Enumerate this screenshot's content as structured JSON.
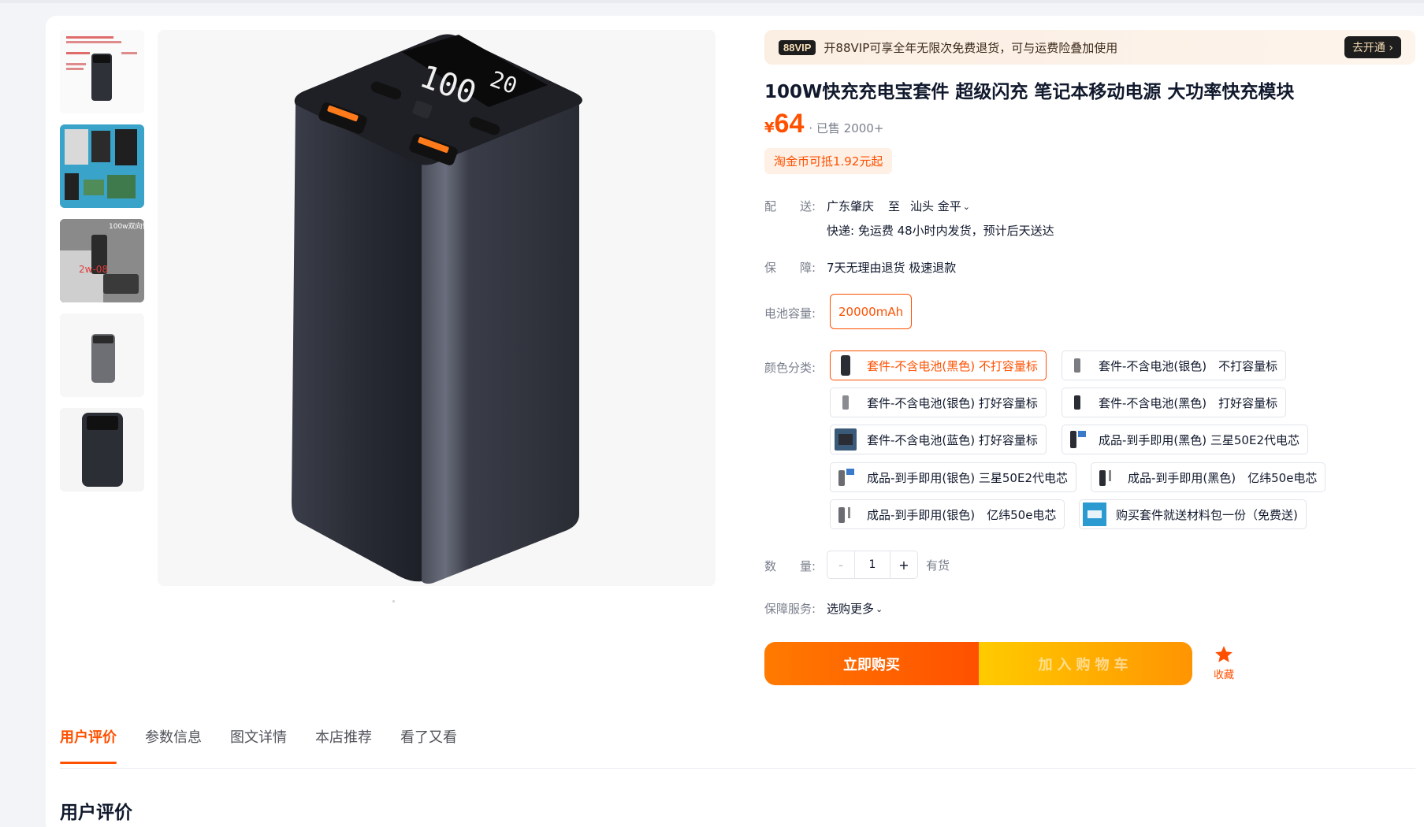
{
  "vip": {
    "badge": "88VIP",
    "text": "开88VIP可享全年无限次免费退货，可与运费险叠加使用",
    "button": "去开通 ›"
  },
  "product": {
    "title": "100W快充充电宝套件 超级闪充 笔记本移动电源 大功率快充模块",
    "price_symbol": "¥",
    "price": "64",
    "sold": "· 已售 2000+",
    "coin_tag": "淘金币可抵1.92元起"
  },
  "delivery": {
    "label": "配　　送:",
    "from": "广东肇庆",
    "to_word": "至",
    "destination": "汕头 金平",
    "detail": "快递: 免运费  48小时内发货，预计后天送达"
  },
  "guarantee": {
    "label": "保　　障:",
    "value": "7天无理由退货 极速退款"
  },
  "capacity": {
    "label": "电池容量:",
    "option": "20000mAh"
  },
  "color": {
    "label": "颜色分类:",
    "options": [
      {
        "label": "套件-不含电池(黑色) 不打容量标"
      },
      {
        "label": "套件-不含电池(银色)　不打容量标"
      },
      {
        "label": "套件-不含电池(银色) 打好容量标"
      },
      {
        "label": "套件-不含电池(黑色)　打好容量标"
      },
      {
        "label": "套件-不含电池(蓝色) 打好容量标"
      },
      {
        "label": "成品-到手即用(黑色) 三星50E2代电芯"
      },
      {
        "label": "成品-到手即用(银色) 三星50E2代电芯"
      },
      {
        "label": "成品-到手即用(黑色)　亿纬50e电芯"
      },
      {
        "label": "成品-到手即用(银色)　亿纬50e电芯"
      },
      {
        "label": "购买套件就送材料包一份（免费送)"
      }
    ]
  },
  "quantity": {
    "label": "数　　量:",
    "minus": "-",
    "value": "1",
    "plus": "+",
    "stock": "有货"
  },
  "service": {
    "label": "保障服务:",
    "value": "选购更多"
  },
  "actions": {
    "buy_now": "立即购买",
    "add_cart": "加入购物车",
    "favorite": "收藏"
  },
  "tabs": [
    "用户评价",
    "参数信息",
    "图文详情",
    "本店推荐",
    "看了又看"
  ],
  "section_title": "用户评价",
  "colors": {
    "accent": "#ff5000",
    "vip_bg": "#fbeee2"
  },
  "icons": {
    "favorite": "star-icon",
    "chevron": "chevron-down-icon"
  }
}
